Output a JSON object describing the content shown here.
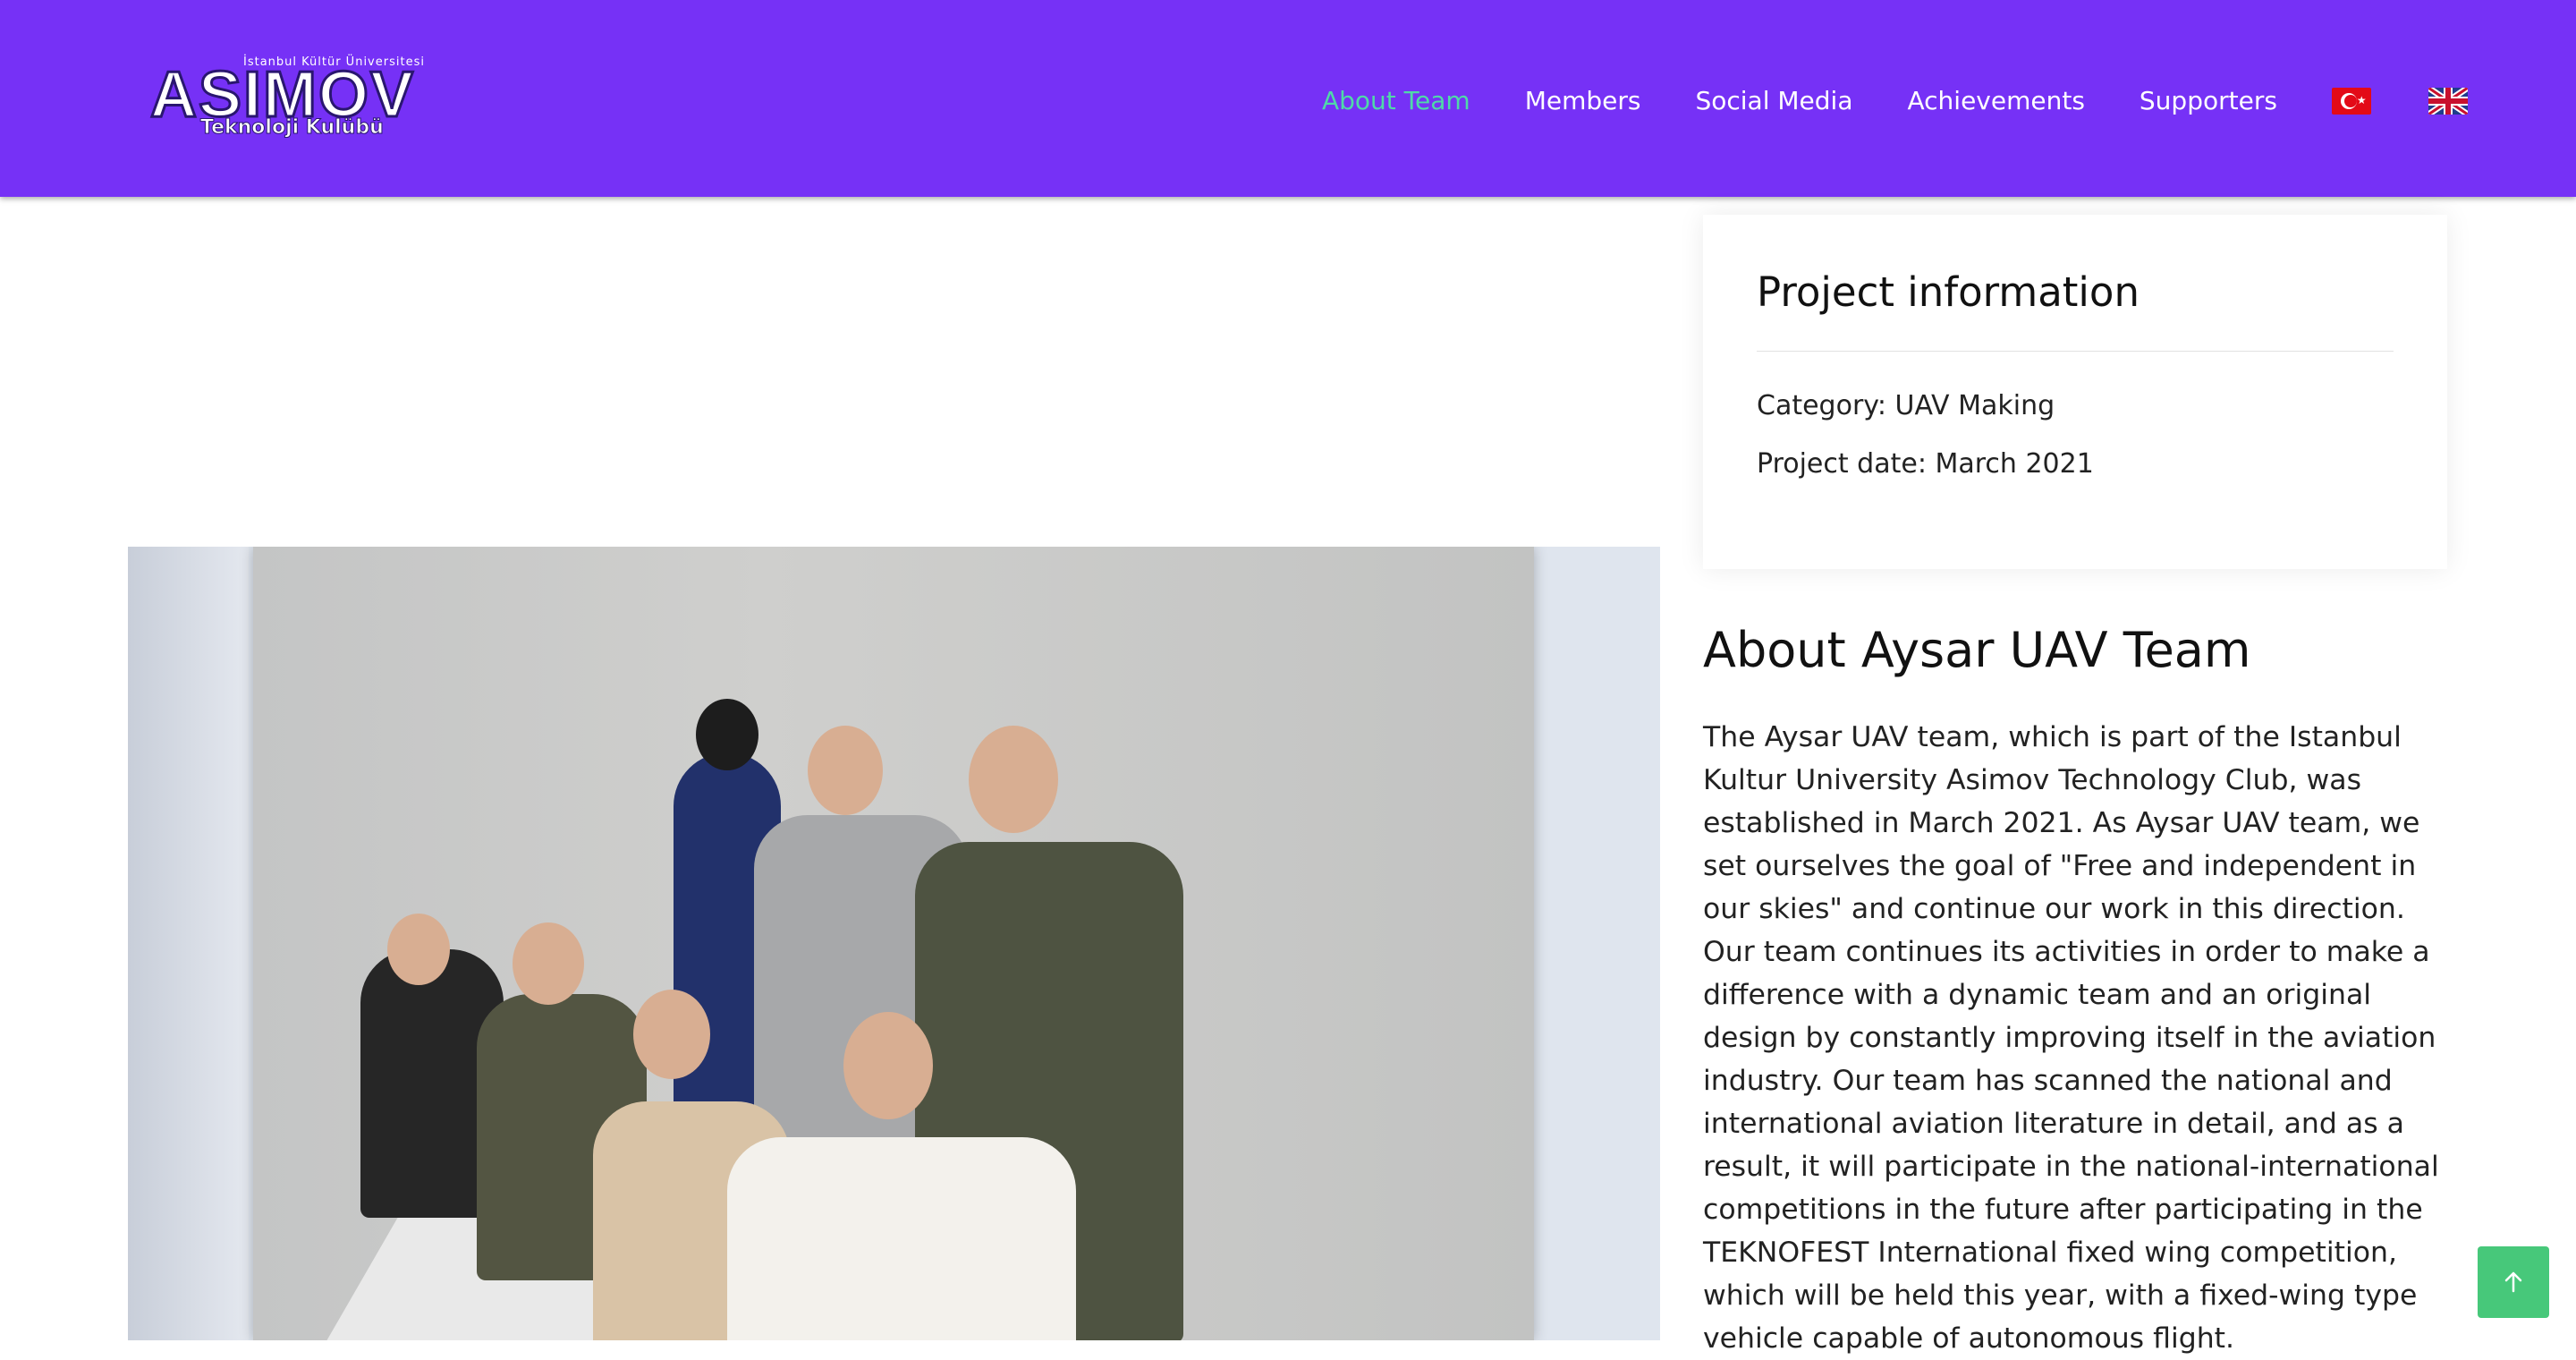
{
  "brand": {
    "logo_small": "İstanbul Kültür Üniversitesi",
    "logo_big": "ASIMOV",
    "logo_sub": "Teknoloji Kulübü"
  },
  "nav": {
    "items": [
      {
        "label": "About Team",
        "active": true
      },
      {
        "label": "Members"
      },
      {
        "label": "Social Media"
      },
      {
        "label": "Achievements"
      },
      {
        "label": "Supporters"
      }
    ],
    "flags": [
      "turkish-flag-icon",
      "uk-flag-icon"
    ],
    "accent": "#4fd9a8",
    "bar_color": "#7631f6"
  },
  "project_info": {
    "title": "Project information",
    "category": "Category: UAV Making",
    "date": "Project date: March 2021"
  },
  "about": {
    "title": "About Aysar UAV Team",
    "text": "The Aysar UAV team, which is part of the Istanbul Kultur University Asimov Technology Club, was established in March 2021. As Aysar UAV team, we set ourselves the goal of \"Free and independent in our skies\" and continue our work in this direction. Our team continues its activities in order to make a difference with a dynamic team and an original design by constantly improving itself in the aviation industry. Our team has scanned the national and international aviation literature in detail, and as a result, it will participate in the national-international competitions in the future after participating in the TEKNOFEST International fixed wing competition, which will be held this year, with a fixed-wing type vehicle capable of autonomous flight."
  },
  "back_to_top": {
    "icon": "arrow-up-icon",
    "color": "#47c87a"
  }
}
